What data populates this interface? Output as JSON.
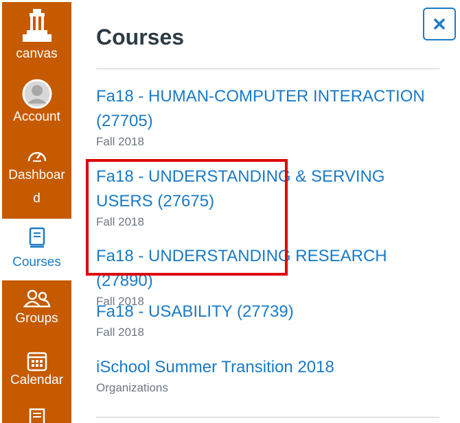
{
  "nav": {
    "logo_label": "canvas",
    "items": [
      {
        "label": "Account",
        "icon": "avatar-icon"
      },
      {
        "label": "Dashboard",
        "icon": "dashboard-gauge-icon"
      },
      {
        "label": "Courses",
        "icon": "book-icon"
      },
      {
        "label": "Groups",
        "icon": "groups-icon"
      },
      {
        "label": "Calendar",
        "icon": "calendar-icon"
      },
      {
        "label": "",
        "icon": "inbox-icon"
      }
    ],
    "active": "Courses"
  },
  "tray": {
    "title": "Courses",
    "close_label": "×",
    "courses": [
      {
        "name": "Fa18 - HUMAN-COMPUTER INTERACTION (27705)",
        "term": "Fall 2018"
      },
      {
        "name": "Fa18 - UNDERSTANDING & SERVING USERS (27675)",
        "term": "Fall 2018"
      },
      {
        "name": "Fa18 - UNDERSTANDING RESEARCH (27890)",
        "term": "Fall 2018"
      },
      {
        "name": "Fa18 - USABILITY (27739)",
        "term": "Fall 2018"
      },
      {
        "name": "iSchool Summer Transition 2018",
        "term": "Organizations"
      }
    ]
  },
  "colors": {
    "nav_bg": "#c55a00",
    "link": "#1a7ac5",
    "highlight": "#e00000"
  }
}
